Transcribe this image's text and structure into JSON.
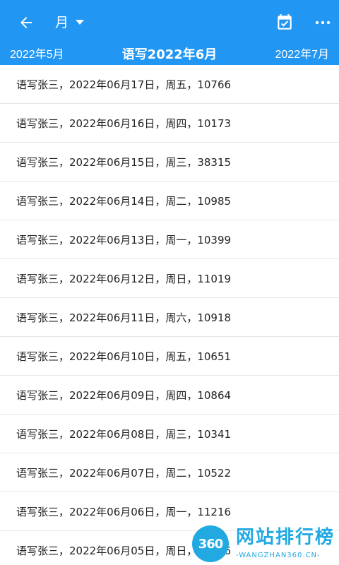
{
  "appbar": {
    "view_mode_label": "月",
    "icons": {
      "back": "arrow-left-icon",
      "dropdown": "caret-down-icon",
      "calendar": "calendar-check-icon",
      "more": "more-horizontal-icon"
    },
    "colors": {
      "background": "#2196f3",
      "foreground": "#ffffff"
    }
  },
  "month_nav": {
    "prev": "2022年5月",
    "current": "语写2022年6月",
    "next": "2022年7月"
  },
  "entries": [
    "语写张三，2022年06月17日，周五，10766",
    "语写张三，2022年06月16日，周四，10173",
    "语写张三，2022年06月15日，周三，38315",
    "语写张三，2022年06月14日，周二，10985",
    "语写张三，2022年06月13日，周一，10399",
    "语写张三，2022年06月12日，周日，11019",
    "语写张三，2022年06月11日，周六，10918",
    "语写张三，2022年06月10日，周五，10651",
    "语写张三，2022年06月09日，周四，10864",
    "语写张三，2022年06月08日，周三，10341",
    "语写张三，2022年06月07日，周二，10522",
    "语写张三，2022年06月06日，周一，11216",
    "语写张三，2022年06月05日，周日，10506"
  ],
  "watermark": {
    "number": "360",
    "title": "网站排行榜",
    "subtitle": "-WANGZHAN360.CN-"
  }
}
